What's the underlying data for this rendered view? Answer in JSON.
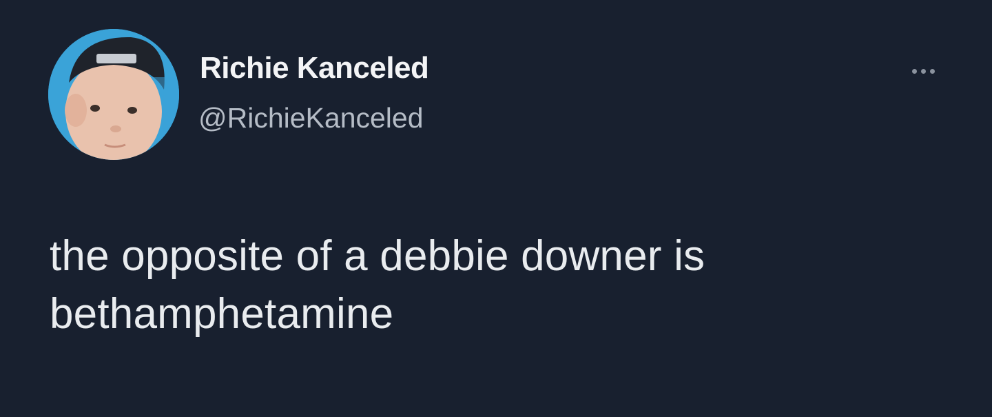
{
  "user": {
    "display_name": "Richie Kanceled",
    "handle": "@RichieKanceled",
    "avatar_icon": "baby-photo-avatar"
  },
  "actions": {
    "more_icon": "ellipsis-icon"
  },
  "tweet": {
    "lines": [
      "the opposite of a debbie downer is",
      "bethamphetamine"
    ]
  },
  "colors": {
    "background": "#18202f",
    "name_text": "#f3f4f6",
    "handle_text": "#b5bcc6",
    "body_text": "#e9ecef",
    "avatar_bg": "#3aa3d8"
  }
}
